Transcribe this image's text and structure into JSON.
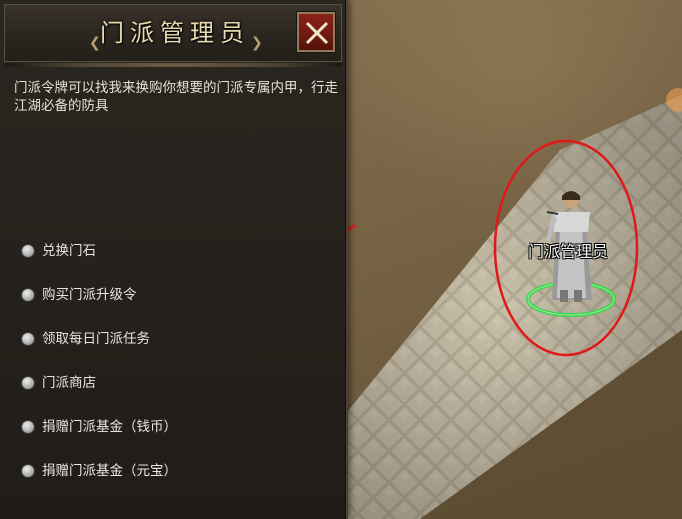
{
  "dialog": {
    "title": "门派管理员",
    "close_icon": "close-x-icon",
    "description": "门派令牌可以找我来换购你想要的门派专属内甲，行走江湖必备的防具",
    "options": [
      {
        "label": "兑换门石"
      },
      {
        "label": "购买门派升级令"
      },
      {
        "label": "领取每日门派任务"
      },
      {
        "label": "门派商店"
      },
      {
        "label": "捐赠门派基金（钱币）"
      },
      {
        "label": "捐赠门派基金（元宝）"
      }
    ]
  },
  "npc": {
    "name": "门派管理员"
  },
  "annotations": {
    "arrow_color": "#e02020",
    "highlight_circle_color": "#e01818",
    "selection_ring_color": "#36d64a"
  },
  "colors": {
    "panel_bg": "#25211c",
    "title_text": "#e9d9ae",
    "close_button": "#6e1911"
  }
}
